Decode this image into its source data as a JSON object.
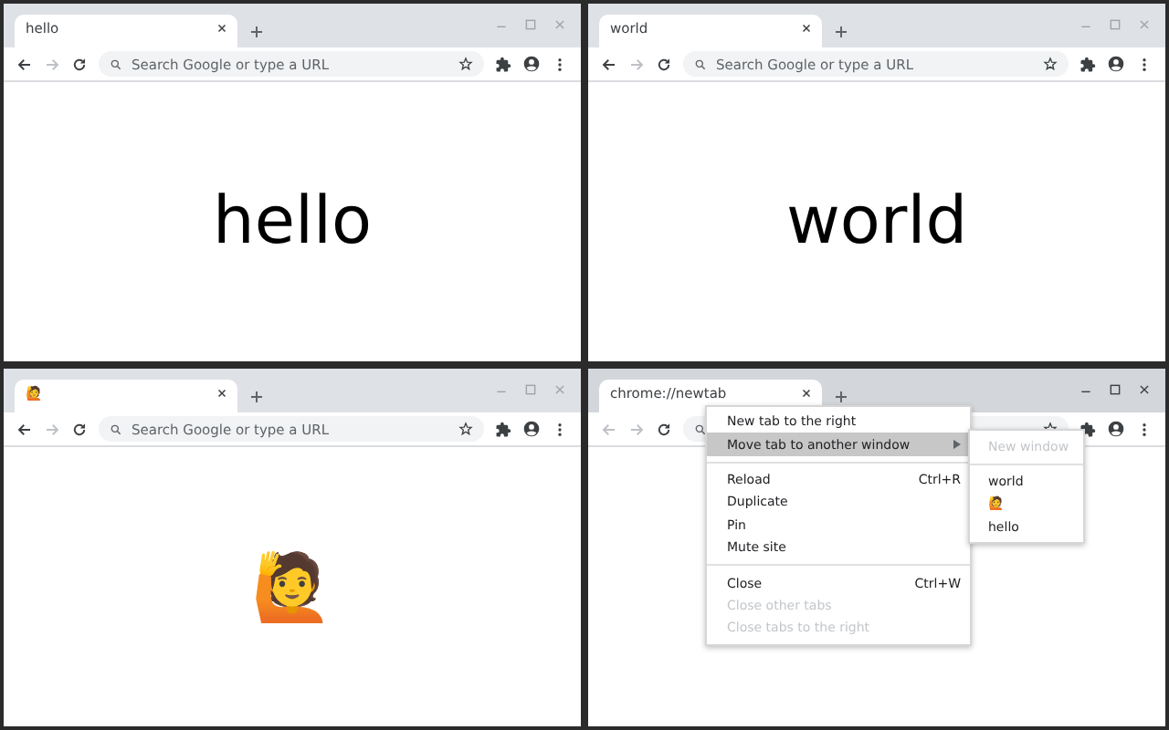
{
  "windows": [
    {
      "active": false,
      "tab_title": "hello",
      "back_disabled": false,
      "forward_disabled": true,
      "omnibox": {
        "placeholder": "Search Google or type a URL"
      },
      "content": "hello"
    },
    {
      "active": false,
      "tab_title": "world",
      "back_disabled": false,
      "forward_disabled": true,
      "omnibox": {
        "placeholder": "Search Google or type a URL"
      },
      "content": "world"
    },
    {
      "active": false,
      "tab_title": "🙋",
      "back_disabled": false,
      "forward_disabled": true,
      "omnibox": {
        "placeholder": "Search Google or type a URL"
      },
      "content": "🙋"
    },
    {
      "active": true,
      "tab_title": "chrome://newtab",
      "back_disabled": true,
      "forward_disabled": true,
      "context_menu": {
        "items": [
          {
            "kind": "item",
            "label": "New tab to the right",
            "disabled": false,
            "selected": false
          },
          {
            "kind": "item",
            "label": "Move tab to another window",
            "disabled": false,
            "selected": true,
            "submenu": [
              {
                "kind": "item",
                "label": "New window",
                "disabled": true,
                "selected": false
              },
              {
                "kind": "separator"
              },
              {
                "kind": "item",
                "label": "world",
                "disabled": false,
                "selected": false
              },
              {
                "kind": "item",
                "label": "🙋",
                "disabled": false,
                "selected": false
              },
              {
                "kind": "item",
                "label": "hello",
                "disabled": false,
                "selected": false
              }
            ]
          },
          {
            "kind": "separator"
          },
          {
            "kind": "item",
            "label": "Reload",
            "shortcut": "Ctrl+R",
            "disabled": false,
            "selected": false
          },
          {
            "kind": "item",
            "label": "Duplicate",
            "disabled": false,
            "selected": false
          },
          {
            "kind": "item",
            "label": "Pin",
            "disabled": false,
            "selected": false
          },
          {
            "kind": "item",
            "label": "Mute site",
            "disabled": false,
            "selected": false
          },
          {
            "kind": "separator"
          },
          {
            "kind": "item",
            "label": "Close",
            "shortcut": "Ctrl+W",
            "disabled": false,
            "selected": false
          },
          {
            "kind": "item",
            "label": "Close other tabs",
            "disabled": true,
            "selected": false
          },
          {
            "kind": "item",
            "label": "Close tabs to the right",
            "disabled": true,
            "selected": false
          }
        ]
      }
    }
  ]
}
